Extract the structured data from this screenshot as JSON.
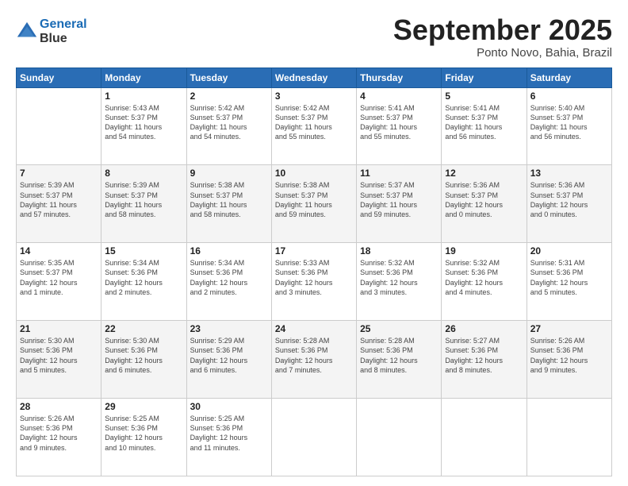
{
  "header": {
    "logo_line1": "General",
    "logo_line2": "Blue",
    "month": "September 2025",
    "location": "Ponto Novo, Bahia, Brazil"
  },
  "weekdays": [
    "Sunday",
    "Monday",
    "Tuesday",
    "Wednesday",
    "Thursday",
    "Friday",
    "Saturday"
  ],
  "weeks": [
    [
      {
        "day": "",
        "info": ""
      },
      {
        "day": "1",
        "info": "Sunrise: 5:43 AM\nSunset: 5:37 PM\nDaylight: 11 hours\nand 54 minutes."
      },
      {
        "day": "2",
        "info": "Sunrise: 5:42 AM\nSunset: 5:37 PM\nDaylight: 11 hours\nand 54 minutes."
      },
      {
        "day": "3",
        "info": "Sunrise: 5:42 AM\nSunset: 5:37 PM\nDaylight: 11 hours\nand 55 minutes."
      },
      {
        "day": "4",
        "info": "Sunrise: 5:41 AM\nSunset: 5:37 PM\nDaylight: 11 hours\nand 55 minutes."
      },
      {
        "day": "5",
        "info": "Sunrise: 5:41 AM\nSunset: 5:37 PM\nDaylight: 11 hours\nand 56 minutes."
      },
      {
        "day": "6",
        "info": "Sunrise: 5:40 AM\nSunset: 5:37 PM\nDaylight: 11 hours\nand 56 minutes."
      }
    ],
    [
      {
        "day": "7",
        "info": "Sunrise: 5:39 AM\nSunset: 5:37 PM\nDaylight: 11 hours\nand 57 minutes."
      },
      {
        "day": "8",
        "info": "Sunrise: 5:39 AM\nSunset: 5:37 PM\nDaylight: 11 hours\nand 58 minutes."
      },
      {
        "day": "9",
        "info": "Sunrise: 5:38 AM\nSunset: 5:37 PM\nDaylight: 11 hours\nand 58 minutes."
      },
      {
        "day": "10",
        "info": "Sunrise: 5:38 AM\nSunset: 5:37 PM\nDaylight: 11 hours\nand 59 minutes."
      },
      {
        "day": "11",
        "info": "Sunrise: 5:37 AM\nSunset: 5:37 PM\nDaylight: 11 hours\nand 59 minutes."
      },
      {
        "day": "12",
        "info": "Sunrise: 5:36 AM\nSunset: 5:37 PM\nDaylight: 12 hours\nand 0 minutes."
      },
      {
        "day": "13",
        "info": "Sunrise: 5:36 AM\nSunset: 5:37 PM\nDaylight: 12 hours\nand 0 minutes."
      }
    ],
    [
      {
        "day": "14",
        "info": "Sunrise: 5:35 AM\nSunset: 5:37 PM\nDaylight: 12 hours\nand 1 minute."
      },
      {
        "day": "15",
        "info": "Sunrise: 5:34 AM\nSunset: 5:36 PM\nDaylight: 12 hours\nand 2 minutes."
      },
      {
        "day": "16",
        "info": "Sunrise: 5:34 AM\nSunset: 5:36 PM\nDaylight: 12 hours\nand 2 minutes."
      },
      {
        "day": "17",
        "info": "Sunrise: 5:33 AM\nSunset: 5:36 PM\nDaylight: 12 hours\nand 3 minutes."
      },
      {
        "day": "18",
        "info": "Sunrise: 5:32 AM\nSunset: 5:36 PM\nDaylight: 12 hours\nand 3 minutes."
      },
      {
        "day": "19",
        "info": "Sunrise: 5:32 AM\nSunset: 5:36 PM\nDaylight: 12 hours\nand 4 minutes."
      },
      {
        "day": "20",
        "info": "Sunrise: 5:31 AM\nSunset: 5:36 PM\nDaylight: 12 hours\nand 5 minutes."
      }
    ],
    [
      {
        "day": "21",
        "info": "Sunrise: 5:30 AM\nSunset: 5:36 PM\nDaylight: 12 hours\nand 5 minutes."
      },
      {
        "day": "22",
        "info": "Sunrise: 5:30 AM\nSunset: 5:36 PM\nDaylight: 12 hours\nand 6 minutes."
      },
      {
        "day": "23",
        "info": "Sunrise: 5:29 AM\nSunset: 5:36 PM\nDaylight: 12 hours\nand 6 minutes."
      },
      {
        "day": "24",
        "info": "Sunrise: 5:28 AM\nSunset: 5:36 PM\nDaylight: 12 hours\nand 7 minutes."
      },
      {
        "day": "25",
        "info": "Sunrise: 5:28 AM\nSunset: 5:36 PM\nDaylight: 12 hours\nand 8 minutes."
      },
      {
        "day": "26",
        "info": "Sunrise: 5:27 AM\nSunset: 5:36 PM\nDaylight: 12 hours\nand 8 minutes."
      },
      {
        "day": "27",
        "info": "Sunrise: 5:26 AM\nSunset: 5:36 PM\nDaylight: 12 hours\nand 9 minutes."
      }
    ],
    [
      {
        "day": "28",
        "info": "Sunrise: 5:26 AM\nSunset: 5:36 PM\nDaylight: 12 hours\nand 9 minutes."
      },
      {
        "day": "29",
        "info": "Sunrise: 5:25 AM\nSunset: 5:36 PM\nDaylight: 12 hours\nand 10 minutes."
      },
      {
        "day": "30",
        "info": "Sunrise: 5:25 AM\nSunset: 5:36 PM\nDaylight: 12 hours\nand 11 minutes."
      },
      {
        "day": "",
        "info": ""
      },
      {
        "day": "",
        "info": ""
      },
      {
        "day": "",
        "info": ""
      },
      {
        "day": "",
        "info": ""
      }
    ]
  ]
}
